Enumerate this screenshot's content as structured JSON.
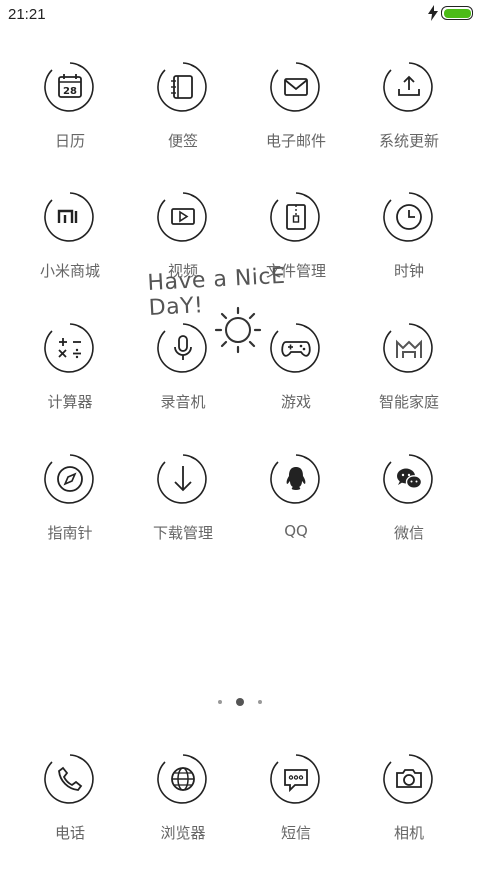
{
  "status_bar": {
    "time": "21:21",
    "battery_color": "#4cbb17"
  },
  "widget": {
    "greeting": "Have a NicE DaY!"
  },
  "pages": {
    "count": 3,
    "active_index": 1
  },
  "apps": [
    {
      "label": "日历",
      "icon": "calendar-icon",
      "icon_text": "28"
    },
    {
      "label": "便签",
      "icon": "notes-icon"
    },
    {
      "label": "电子邮件",
      "icon": "mail-icon"
    },
    {
      "label": "系统更新",
      "icon": "system-update-icon"
    },
    {
      "label": "小米商城",
      "icon": "mi-store-icon",
      "icon_text": "mi"
    },
    {
      "label": "视频",
      "icon": "video-icon"
    },
    {
      "label": "文件管理",
      "icon": "file-manager-icon"
    },
    {
      "label": "时钟",
      "icon": "clock-icon"
    },
    {
      "label": "计算器",
      "icon": "calculator-icon",
      "icon_text": "+-×÷"
    },
    {
      "label": "录音机",
      "icon": "recorder-icon"
    },
    {
      "label": "游戏",
      "icon": "game-controller-icon"
    },
    {
      "label": "智能家庭",
      "icon": "smart-home-icon"
    },
    {
      "label": "指南针",
      "icon": "compass-icon"
    },
    {
      "label": "下载管理",
      "icon": "download-icon"
    },
    {
      "label": "QQ",
      "icon": "qq-icon"
    },
    {
      "label": "微信",
      "icon": "wechat-icon"
    }
  ],
  "dock": [
    {
      "label": "电话",
      "icon": "phone-icon"
    },
    {
      "label": "浏览器",
      "icon": "browser-icon"
    },
    {
      "label": "短信",
      "icon": "messages-icon"
    },
    {
      "label": "相机",
      "icon": "camera-icon"
    }
  ]
}
